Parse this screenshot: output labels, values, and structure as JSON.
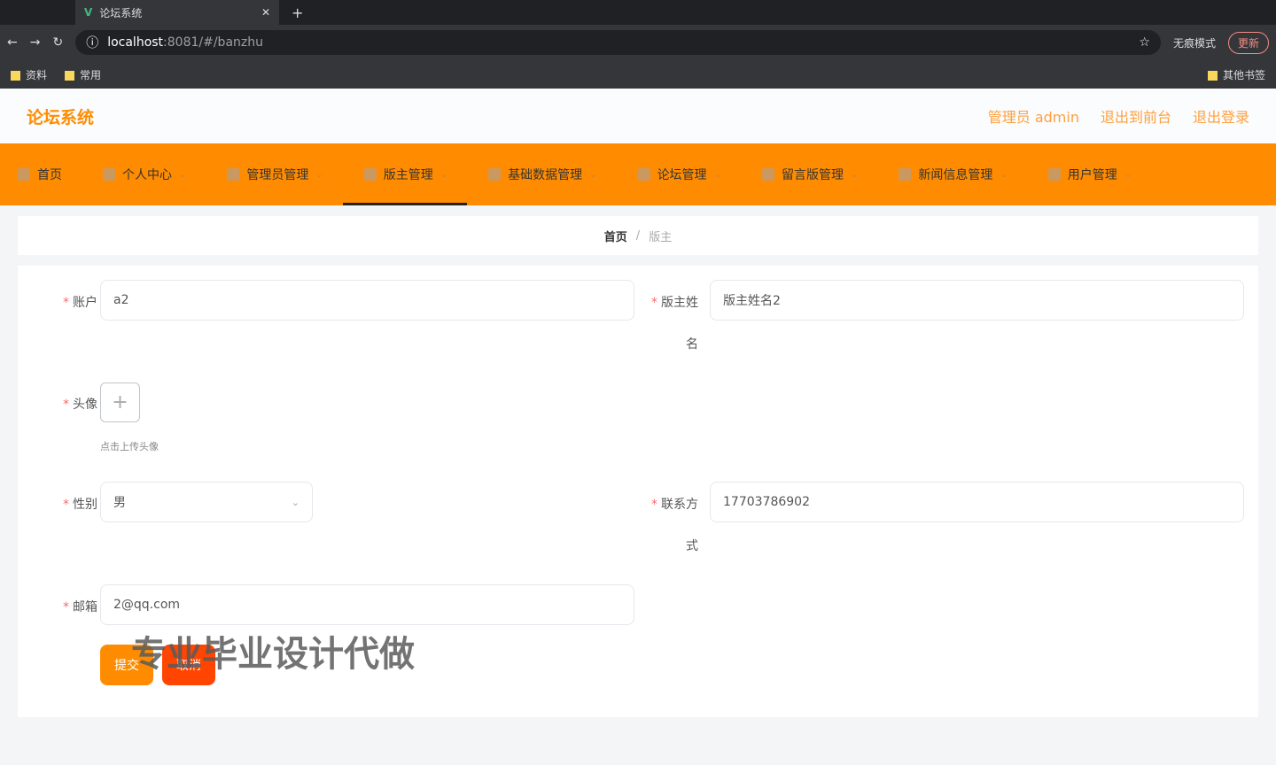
{
  "browser": {
    "tab_title": "论坛系统",
    "url_host": "localhost",
    "url_rest": ":8081/#/banzhu",
    "incognito": "无痕模式",
    "update": "更新",
    "bookmarks": [
      "资料",
      "常用"
    ],
    "other_bookmarks": "其他书签"
  },
  "header": {
    "logo": "论坛系统",
    "links": [
      "管理员 admin",
      "退出到前台",
      "退出登录"
    ]
  },
  "nav": [
    {
      "label": "首页",
      "arrow": false
    },
    {
      "label": "个人中心",
      "arrow": true
    },
    {
      "label": "管理员管理",
      "arrow": true
    },
    {
      "label": "版主管理",
      "arrow": true,
      "active": true
    },
    {
      "label": "基础数据管理",
      "arrow": true
    },
    {
      "label": "论坛管理",
      "arrow": true
    },
    {
      "label": "留言版管理",
      "arrow": true
    },
    {
      "label": "新闻信息管理",
      "arrow": true
    },
    {
      "label": "用户管理",
      "arrow": true
    }
  ],
  "breadcrumb": {
    "home": "首页",
    "sep": "/",
    "current": "版主"
  },
  "form": {
    "account_label": "账户",
    "account": "a2",
    "name_label_1": "版主姓",
    "name_label_2": "名",
    "name": "版主姓名2",
    "avatar_label": "头像",
    "upload_plus": "+",
    "avatar_tip": "点击上传头像",
    "gender_label": "性别",
    "gender": "男",
    "phone_label_1": "联系方",
    "phone_label_2": "式",
    "phone": "17703786902",
    "email_label": "邮箱",
    "email": "2@qq.com",
    "submit": "提交",
    "cancel": "取消",
    "required": "*"
  },
  "watermark": "专业毕业设计代做"
}
